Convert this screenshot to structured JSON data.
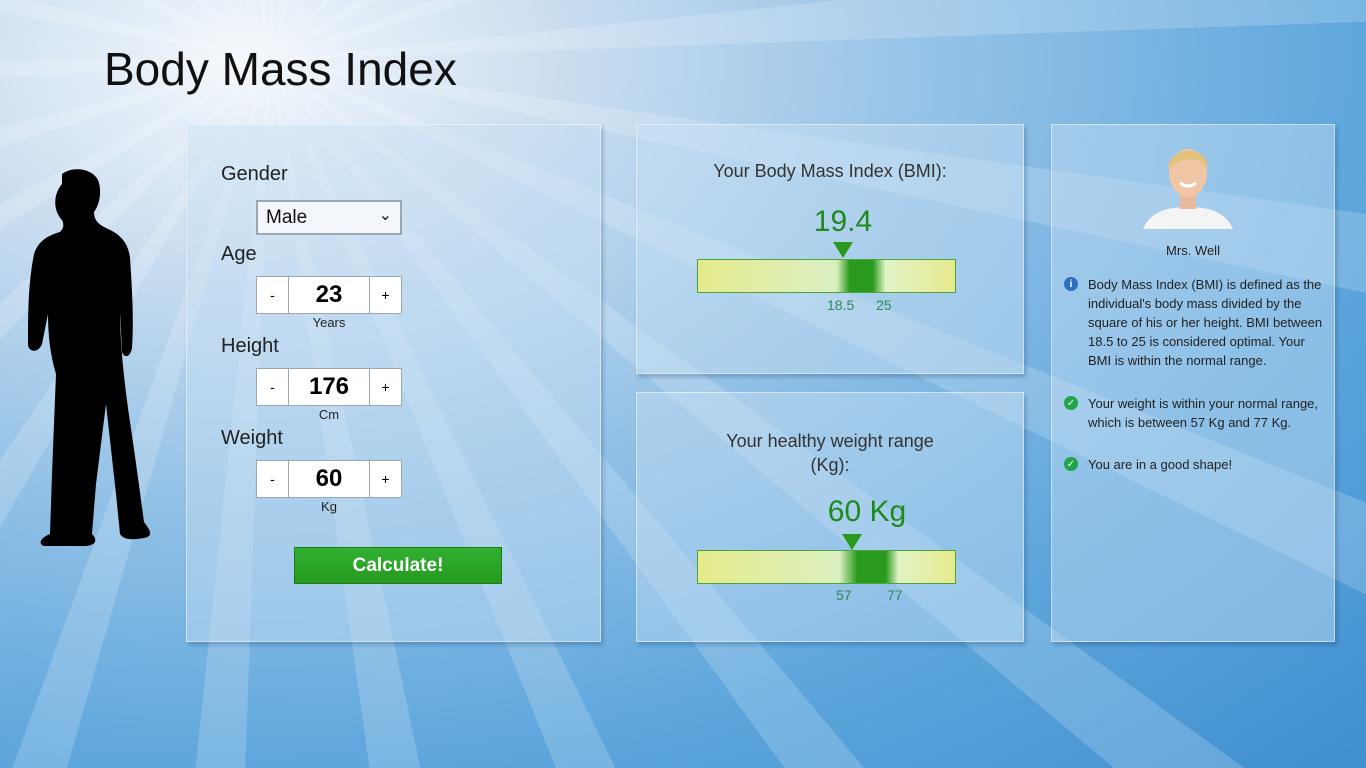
{
  "title": "Body Mass Index",
  "form": {
    "gender_label": "Gender",
    "gender_value": "Male",
    "age_label": "Age",
    "age_value": "23",
    "age_unit": "Years",
    "height_label": "Height",
    "height_value": "176",
    "height_unit": "Cm",
    "weight_label": "Weight",
    "weight_value": "60",
    "weight_unit": "Kg",
    "minus": "-",
    "plus": "+",
    "calculate": "Calculate!"
  },
  "bmi": {
    "title": "Your Body Mass Index (BMI):",
    "value": "19.4",
    "low": "18.5",
    "high": "25"
  },
  "weight_range": {
    "title": "Your healthy weight range (Kg):",
    "value": "60 Kg",
    "low": "57",
    "high": "77"
  },
  "advisor": {
    "name": "Mrs. Well",
    "notes": [
      {
        "icon": "info-icon",
        "text": "Body Mass Index (BMI) is defined as the individual's body mass divided by the square of his or her height. BMI between 18.5 to 25 is considered optimal. Your BMI is within the normal range."
      },
      {
        "icon": "check-icon",
        "text": "Your weight is within your normal range, which is between 57 Kg and 77 Kg."
      },
      {
        "icon": "check-icon",
        "text": "You are in a good shape!"
      }
    ]
  },
  "colors": {
    "accent": "#2a9a1e",
    "info": "#2f6fc0"
  }
}
